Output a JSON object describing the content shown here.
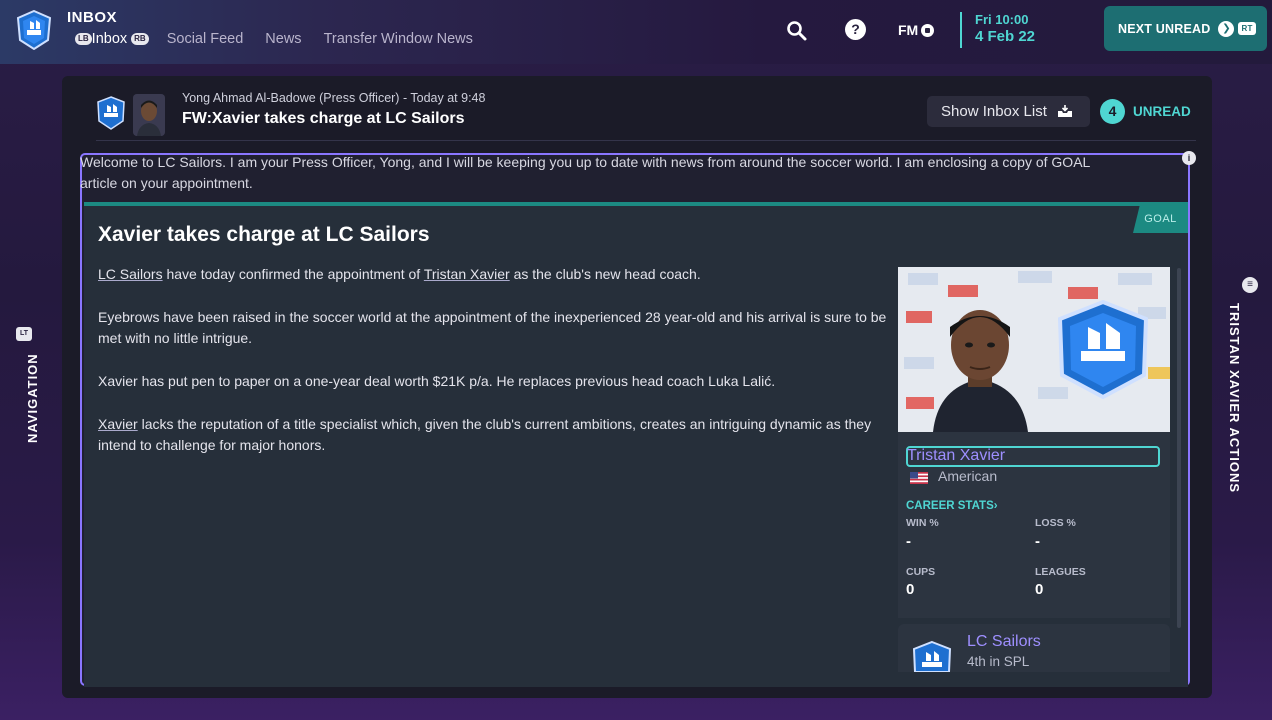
{
  "header": {
    "title": "INBOX",
    "tabs": [
      {
        "label": "Inbox",
        "active": true
      },
      {
        "label": "Social Feed"
      },
      {
        "label": "News"
      },
      {
        "label": "Transfer Window News"
      }
    ],
    "lb_glyph": "LB",
    "rb_glyph": "RB",
    "fm_label": "FM",
    "date": {
      "time": "Fri 10:00",
      "day": "4 Feb 22"
    },
    "next_unread": {
      "label": "NEXT UNREAD",
      "glyph": "RT"
    }
  },
  "message": {
    "sender": "Yong Ahmad Al-Badowe (Press Officer)",
    "separator": "-",
    "time": "Today at 9:48",
    "subject": "FW:Xavier takes charge at LC Sailors",
    "show_inbox_label": "Show Inbox List",
    "unread_count": "4",
    "unread_label": "UNREAD",
    "intro_line1": "Welcome to LC Sailors. I am your Press Officer, Yong, and I will be keeping you up to date with news from around the soccer world. I am enclosing a copy of GOAL",
    "intro_line2": "article on your appointment.",
    "info_glyph": "i"
  },
  "article": {
    "tag": "GOAL",
    "headline": "Xavier takes charge at LC Sailors",
    "p1": {
      "club": "LC Sailors",
      "a": " have today confirmed the appointment of ",
      "person": "Tristan Xavier",
      "b": " as the club's new head coach."
    },
    "p2": "Eyebrows have been raised in the soccer world at the appointment of the inexperienced 28 year-old and his arrival is sure to be met with no little intrigue.",
    "p3": "Xavier has put pen to paper on a one-year deal worth $21K p/a. He replaces previous head coach Luka Lalić.",
    "p4": {
      "person": "Xavier",
      "a": " lacks the reputation of a title specialist which, given the club's current ambitions, creates an intriguing dynamic as they intend to challenge for major honors."
    }
  },
  "profile": {
    "name": "Tristan Xavier",
    "nationality": "American",
    "career_link": "CAREER STATS",
    "stats": {
      "win_label": "WIN %",
      "win_value": "-",
      "loss_label": "LOSS %",
      "loss_value": "-",
      "cups_label": "CUPS",
      "cups_value": "0",
      "leagues_label": "LEAGUES",
      "leagues_value": "0"
    },
    "club": {
      "name": "LC Sailors",
      "position": "4th in SPL"
    }
  },
  "side": {
    "left_label": "NAVIGATION",
    "left_glyph": "LT",
    "right_label": "TRISTAN XAVIER ACTIONS",
    "right_glyph": "≡"
  },
  "colors": {
    "accent": "#4fd6d2",
    "link": "#9e8fff",
    "focus": "#8a76ff",
    "goal": "#1c8a82",
    "next_unread_bg": "#1d6e72"
  },
  "icons": [
    "club-badge-icon",
    "search-icon",
    "help-icon",
    "fm-icon",
    "chevron-right-icon",
    "inbox-tray-icon",
    "flag-us-icon"
  ]
}
